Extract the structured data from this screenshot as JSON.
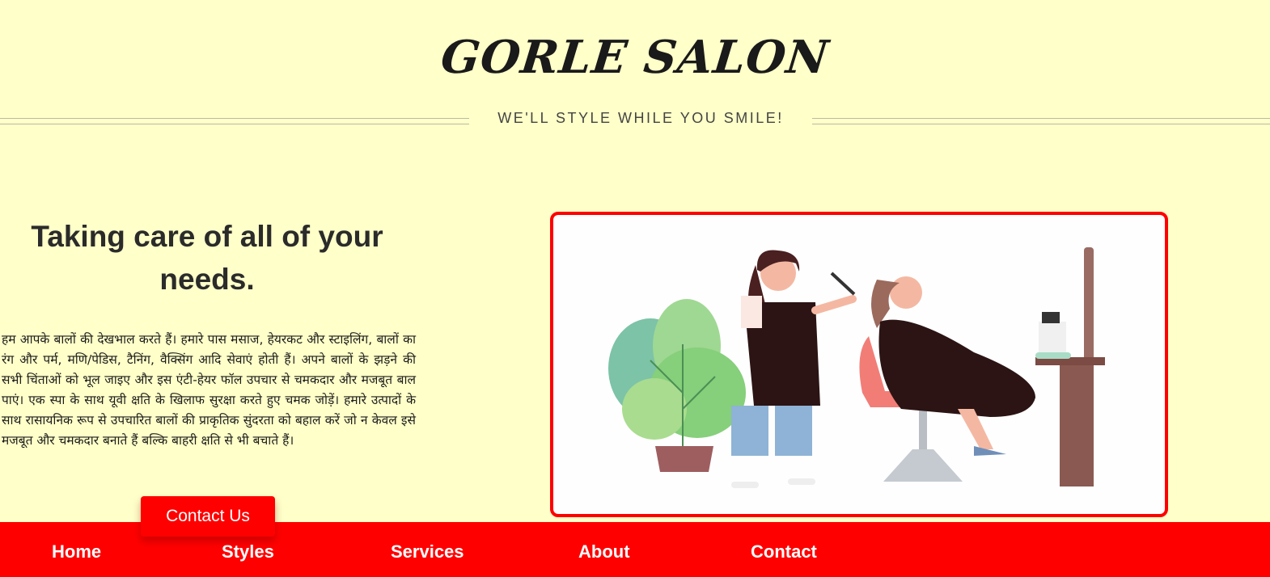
{
  "header": {
    "brand": "GORLE SALON",
    "tagline": "WE'LL STYLE WHILE YOU SMILE!"
  },
  "main": {
    "heading": "Taking care of all of your needs.",
    "description": "हम आपके बालों की देखभाल करते हैं। हमारे पास मसाज, हेयरकट और स्टाइलिंग, बालों का रंग और पर्म, मणि/पेडिस, टैनिंग, वैक्सिंग आदि सेवाएं होती हैं। अपने बालों के झड़ने की सभी चिंताओं को भूल जाइए और इस एंटी-हेयर फॉल उपचार से चमकदार और मजबूत बाल पाएं। एक स्पा के साथ यूवी क्षति के खिलाफ सुरक्षा करते हुए चमक जोड़ें। हमारे उत्पादों के साथ रासायनिक रूप से उपचारित बालों की प्राकृतिक सुंदरता को बहाल करें जो न केवल इसे मजबूत और चमकदार बनाते हैं बल्कि बाहरी क्षति से भी बचाते हैं।",
    "contact_button": "Contact Us"
  },
  "nav": {
    "items": [
      "Home",
      "Styles",
      "Services",
      "About",
      "Contact"
    ]
  },
  "colors": {
    "background": "#ffffc9",
    "accent": "#ff0000",
    "text": "#2b2b2b"
  }
}
